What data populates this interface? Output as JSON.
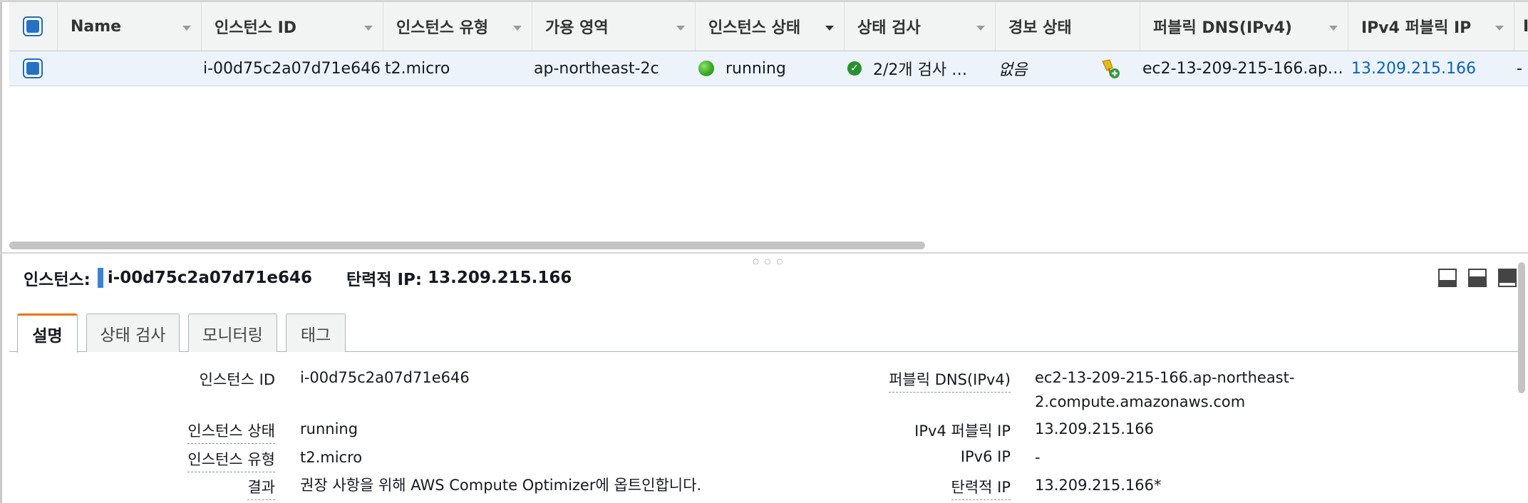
{
  "grid": {
    "columns": [
      {
        "label": "Name"
      },
      {
        "label": "인스턴스 ID"
      },
      {
        "label": "인스턴스 유형"
      },
      {
        "label": "가용 영역"
      },
      {
        "label": "인스턴스 상태"
      },
      {
        "label": "상태 검사"
      },
      {
        "label": "경보 상태"
      },
      {
        "label": "퍼블릭 DNS(IPv4)"
      },
      {
        "label": "IPv4 퍼블릭 IP"
      },
      {
        "label": "I"
      }
    ],
    "row": {
      "name": "",
      "instance_id": "i-00d75c2a07d71e646",
      "instance_type": "t2.micro",
      "availability_zone": "ap-northeast-2c",
      "instance_state": "running",
      "status_check": "2/2개 검사 …",
      "alarm_status": "없음",
      "public_dns": "ec2-13-209-215-166.ap…",
      "ipv4_public_ip": "13.209.215.166",
      "extra": "-"
    }
  },
  "detail": {
    "instance_label": "인스턴스:",
    "instance_id": "i-00d75c2a07d71e646",
    "elastic_ip_label": "탄력적 IP:",
    "elastic_ip": "13.209.215.166",
    "tabs": [
      {
        "label": "설명"
      },
      {
        "label": "상태 검사"
      },
      {
        "label": "모니터링"
      },
      {
        "label": "태그"
      }
    ],
    "left": {
      "instance_id_label": "인스턴스 ID",
      "instance_id_value": "i-00d75c2a07d71e646",
      "instance_state_label": "인스턴스 상태",
      "instance_state_value": "running",
      "instance_type_label": "인스턴스 유형",
      "instance_type_value": "t2.micro",
      "finding_label": "결과",
      "finding_value": "권장 사항을 위해 AWS Compute Optimizer에 옵트인합니다."
    },
    "right": {
      "public_dns_label": "퍼블릭 DNS(IPv4)",
      "public_dns_line1": "ec2-13-209-215-166.ap-northeast-",
      "public_dns_line2": "2.compute.amazonaws.com",
      "ipv4_label": "IPv4 퍼블릭 IP",
      "ipv4_value": "13.209.215.166",
      "ipv6_label": "IPv6 IP",
      "ipv6_value": "-",
      "elastic_label": "탄력적 IP",
      "elastic_value": "13.209.215.166*"
    }
  },
  "colors": {
    "accent": "#ec7211",
    "link": "#0b63b8",
    "selected_row": "#ecf3fb",
    "running": "#3ba826"
  },
  "icons": {
    "alarm_add": "alarm-add-icon",
    "pane_layouts": [
      "pane-bottom-icon",
      "pane-half-icon",
      "pane-top-icon"
    ]
  }
}
